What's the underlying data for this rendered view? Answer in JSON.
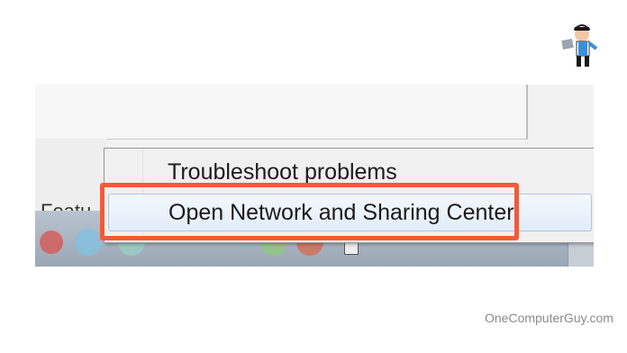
{
  "context_menu": {
    "items": [
      {
        "label": "Troubleshoot problems"
      },
      {
        "label": "Open Network and Sharing Center"
      }
    ]
  },
  "background_window": {
    "partial_label": "Featu"
  },
  "watermark": "OneComputerGuy.com",
  "colors": {
    "highlight": "#f25a39",
    "menu_bg": "#f0f0f0",
    "selected_item_bg": "#e2edf9"
  }
}
